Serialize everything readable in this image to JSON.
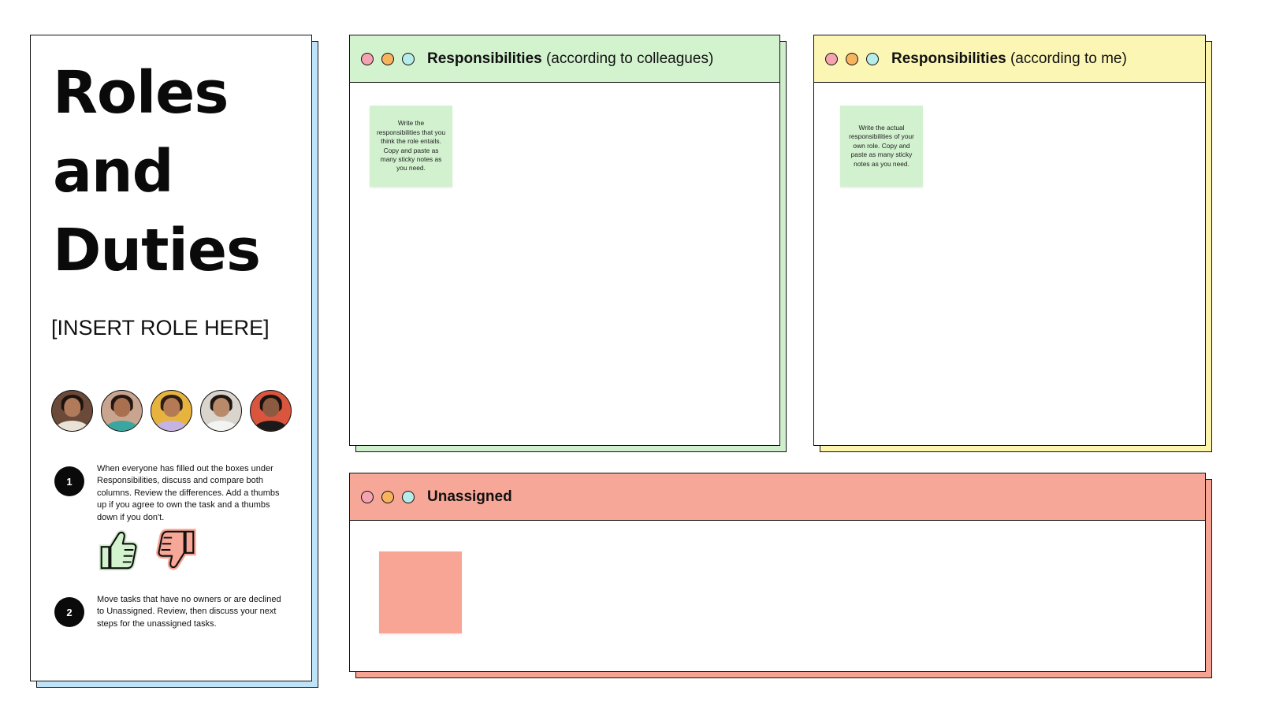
{
  "info": {
    "title_line1": "Roles",
    "title_line2": "and",
    "title_line3": "Duties",
    "role_placeholder": "[INSERT ROLE HERE]",
    "steps": [
      {
        "number": "1",
        "text": "When everyone has filled out the boxes under Responsibilities, discuss and compare both columns. Review the differences. Add a thumbs up if you agree to own the task and a thumbs down if you don't."
      },
      {
        "number": "2",
        "text": "Move tasks that have no owners or are declined to Unassigned. Review, then discuss your next steps for the unassigned tasks."
      }
    ],
    "icons": [
      "thumbs-up-icon",
      "thumbs-down-icon"
    ]
  },
  "panels": {
    "colleagues": {
      "title_bold": "Responsibilities",
      "title_rest": " (according to colleagues)",
      "sticky_text": "Write the responsibilities that you think the role entails. Copy and paste as many sticky notes as you need.",
      "header_color": "#d3f3cf"
    },
    "me": {
      "title_bold": "Responsibilities",
      "title_rest": " (according to me)",
      "sticky_text": "Write the actual responsibilities of your own role. Copy and paste as many sticky notes as you need.",
      "header_color": "#fcf6b4"
    },
    "unassigned": {
      "title_bold": "Unassigned",
      "title_rest": "",
      "header_color": "#f7a797"
    }
  },
  "colors": {
    "info_shadow": "#bfe3f8",
    "dot_red": "#f5a3b0",
    "dot_orange": "#f7b35e",
    "dot_teal": "#b6ecea",
    "sticky_green": "#d2f1cf",
    "sticky_salmon": "#f8a595"
  }
}
